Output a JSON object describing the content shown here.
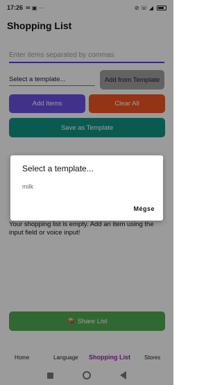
{
  "status_bar": {
    "time": "17:26",
    "left_icons": "✉ ▣ ···",
    "right_icons": "⊘ ☏ ◢"
  },
  "page_title": "Shopping List",
  "items_input": {
    "placeholder": "Enter items separated by commas",
    "value": ""
  },
  "template_select": {
    "selected": "Select a template..."
  },
  "buttons": {
    "add_from_template": "Add from Template",
    "add_items": "Add Items",
    "clear_all": "Clear All",
    "save_as_template": "Save as Template",
    "share_list": "Share List"
  },
  "empty_message": "Your shopping list is empty. Add an item using the input field or voice input!",
  "bottom_nav": [
    {
      "label": "Home"
    },
    {
      "label": "Language"
    },
    {
      "label": "Shopping List"
    },
    {
      "label": "Stores"
    }
  ],
  "dialog": {
    "title": "Select a template...",
    "options": [
      "milk"
    ],
    "cancel_label": "Mégse"
  },
  "colors": {
    "accent": "#6a4fe0",
    "clear": "#ee5422",
    "save": "#129184",
    "share": "#4fa950",
    "active_nav": "#8e24aa"
  },
  "icons": {
    "share": "share-box-icon"
  }
}
